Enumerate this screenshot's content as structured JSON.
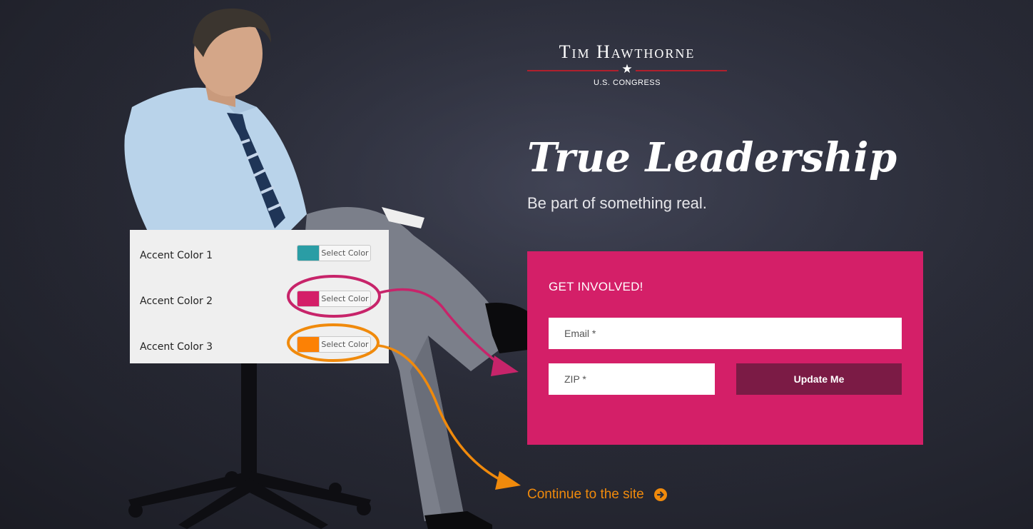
{
  "brand": {
    "name_first": "Tim",
    "name_last": "Hawthorne",
    "subtitle": "U.S. Congress",
    "rule_color": "#b0202d"
  },
  "hero": {
    "headline": "True Leadership",
    "subhead": "Be part of something real."
  },
  "form": {
    "title": "GET INVOLVED!",
    "email_placeholder": "Email *",
    "zip_placeholder": "ZIP *",
    "submit_label": "Update Me",
    "bg_color": "#d41f68",
    "button_color": "#7b1b45"
  },
  "continue_link": {
    "label": "Continue to the site",
    "icon": "arrow-circle-right-icon",
    "color": "#f08a0c"
  },
  "settings_panel": {
    "rows": [
      {
        "label": "Accent Color 1",
        "button_label": "Select Color",
        "swatch": "#2a9da5"
      },
      {
        "label": "Accent Color 2",
        "button_label": "Select Color",
        "swatch": "#d41f68"
      },
      {
        "label": "Accent Color 3",
        "button_label": "Select Color",
        "swatch": "#fc8105"
      }
    ]
  },
  "annotations": [
    {
      "target": "form-card",
      "color": "#d41f68"
    },
    {
      "target": "continue-link",
      "color": "#f08a0c"
    }
  ]
}
